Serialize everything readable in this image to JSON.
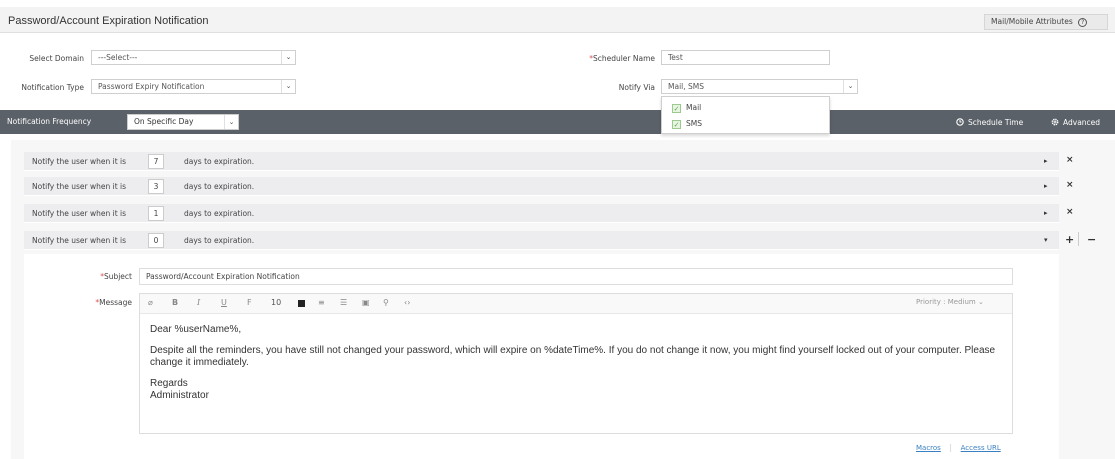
{
  "header": {
    "title": "Password/Account Expiration Notification",
    "attributes_button": "Mail/Mobile Attributes",
    "help_icon": "?"
  },
  "form": {
    "domain_label": "Select Domain",
    "domain_value": "---Select---",
    "notification_type_label": "Notification Type",
    "notification_type_value": "Password Expiry Notification",
    "scheduler_name_label": "Scheduler Name",
    "scheduler_name_value": "Test",
    "notify_via_label": "Notify Via",
    "notify_via_value": "Mail, SMS",
    "notify_via_options": [
      {
        "label": "Mail",
        "checked": true
      },
      {
        "label": "SMS",
        "checked": true
      }
    ],
    "required_mark": "*",
    "check_mark": "✓",
    "dropdown_arrow": "⌄"
  },
  "frequency_bar": {
    "label": "Notification Frequency",
    "value": "On Specific Day",
    "schedule_time": "Schedule Time",
    "advanced": "Advanced"
  },
  "reminders": {
    "prefix": "Notify the user when it is",
    "suffix": "days to expiration.",
    "rows": [
      {
        "days": "7"
      },
      {
        "days": "3"
      },
      {
        "days": "1"
      },
      {
        "days": "0"
      }
    ],
    "remove_icon": "×",
    "add_icon": "+",
    "minus_icon": "−"
  },
  "message": {
    "subject_label": "Subject",
    "subject_value": "Password/Account Expiration Notification",
    "message_label": "Message",
    "toolbar": {
      "bold": "B",
      "italic": "I",
      "underline": "U",
      "font": "F",
      "font_size": "10",
      "priority": "Priority : Medium"
    },
    "body": {
      "greeting": "Dear %userName%,",
      "paragraph": "Despite all the reminders, you have still not changed your password, which will expire on %dateTime%. If you do not change it now, you might find yourself locked out of your computer. Please change it immediately.",
      "regards": "Regards",
      "signature": "Administrator"
    },
    "links": {
      "macros": "Macros",
      "separator": "|",
      "access_url": "Access URL"
    }
  }
}
